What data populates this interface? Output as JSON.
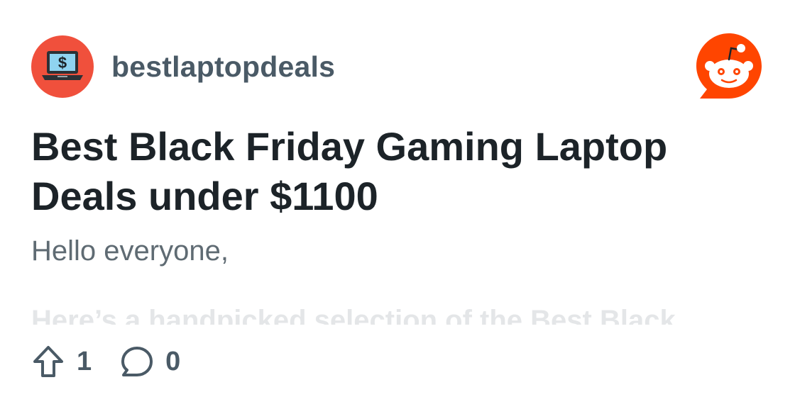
{
  "post": {
    "author": "bestlaptopdeals",
    "title": "Best Black Friday Gaming Laptop Deals under $1100",
    "body_first_line": "Hello everyone,",
    "body_faded_line": "Here’s a handpicked selection of the Best Black",
    "upvotes": "1",
    "comments": "0"
  },
  "icons": {
    "avatar": "laptop-dollar-icon",
    "brand": "reddit-snoo-logo",
    "upvote": "upvote-arrow-icon",
    "comment": "comment-bubble-icon"
  },
  "colors": {
    "avatar_bg": "#f0503c",
    "brand_orange": "#ff4500",
    "username": "#4a5a66",
    "title": "#1c2328",
    "body": "#5f6b73"
  }
}
